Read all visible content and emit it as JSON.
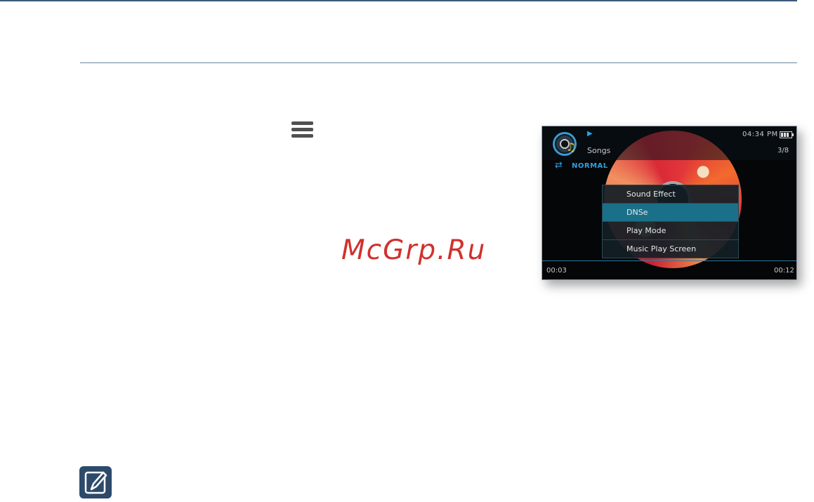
{
  "document": {
    "watermark": "McGrp.Ru",
    "menu_icon": "hamburger-menu-icon",
    "note_icon": "note-pencil-icon"
  },
  "player": {
    "status": {
      "play_indicator": "▶",
      "clock": "04:34 PM",
      "battery_icon": "battery-icon"
    },
    "now_playing": {
      "category": "Songs",
      "track_count": "3/8",
      "album_icon": "album-disc-icon"
    },
    "play_mode": {
      "icon": "repeat-icon",
      "label": "NORMAL"
    },
    "menu": {
      "items": [
        {
          "label": "Sound Effect"
        },
        {
          "label": "DNSe",
          "selected": true
        },
        {
          "label": "Play Mode"
        },
        {
          "label": "Music Play Screen"
        }
      ]
    },
    "progress": {
      "elapsed": "00:03",
      "total": "00:12"
    }
  },
  "colors": {
    "accent": "#2aa0e0",
    "menu_selected": "#1a7088",
    "rule": "#3a5a78"
  }
}
